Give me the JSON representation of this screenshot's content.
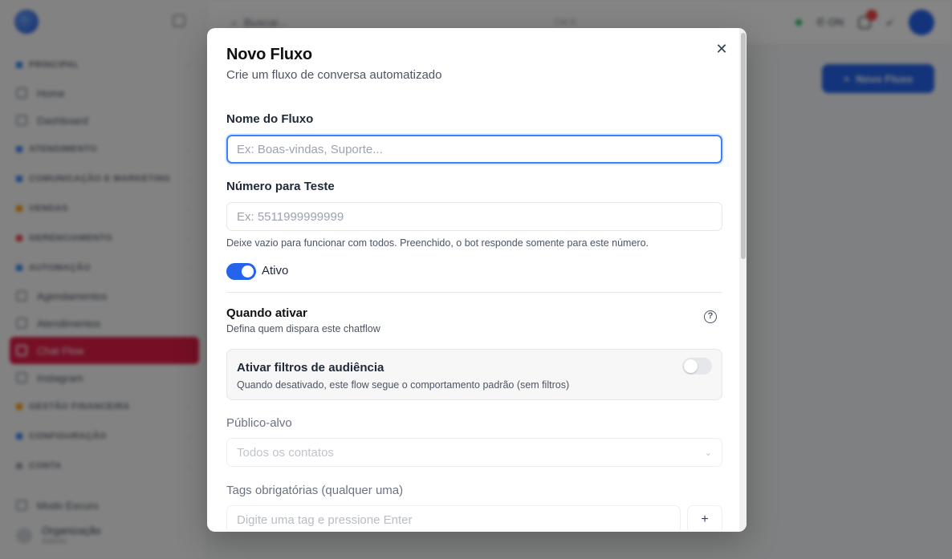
{
  "background": {
    "sidebar": {
      "sections": [
        {
          "label": "PRINCIPAL",
          "color": "#3b82f6"
        },
        {
          "label": "Home",
          "type": "item"
        },
        {
          "label": "Dashboard",
          "type": "item"
        },
        {
          "label": "ATENDIMENTO",
          "color": "#3b82f6"
        },
        {
          "label": "COMUNICAÇÃO E MARKETING",
          "color": "#3b82f6"
        },
        {
          "label": "VENDAS",
          "color": "#f59e0b"
        },
        {
          "label": "GERENCIAMENTO",
          "color": "#ef4444"
        },
        {
          "label": "AUTOMAÇÃO",
          "color": "#3b82f6"
        },
        {
          "label": "Agendamentos",
          "type": "item"
        },
        {
          "label": "Atendimentos",
          "type": "item"
        },
        {
          "label": "Chat Flow",
          "type": "item",
          "active": true
        },
        {
          "label": "Instagram",
          "type": "item"
        },
        {
          "label": "GESTÃO FINANCEIRA",
          "color": "#f59e0b"
        },
        {
          "label": "CONFIGURAÇÃO",
          "color": "#3b82f6"
        },
        {
          "label": "CONTA",
          "color": "#9ca3af"
        }
      ],
      "footer_link": "Modo Escuro",
      "user_name": "Organização",
      "user_role": "Admin"
    },
    "topbar": {
      "search_placeholder": "Buscar...",
      "search_shortcut": "Ctrl K",
      "status": "ON"
    },
    "new_flow_button": "Novo Fluxo"
  },
  "modal": {
    "title": "Novo Fluxo",
    "subtitle": "Crie um fluxo de conversa automatizado",
    "name_label": "Nome do Fluxo",
    "name_placeholder": "Ex: Boas-vindas, Suporte...",
    "name_value": "",
    "test_number_label": "Número para Teste",
    "test_number_placeholder": "Ex: 5511999999999",
    "test_number_value": "",
    "test_number_help": "Deixe vazio para funcionar com todos. Preenchido, o bot responde somente para este número.",
    "active_label": "Ativo",
    "active_on": true,
    "trigger_title": "Quando ativar",
    "trigger_subtitle": "Defina quem dispara este chatflow",
    "audience_filter_title": "Ativar filtros de audiência",
    "audience_filter_subtitle": "Quando desativado, este flow segue o comportamento padrão (sem filtros)",
    "audience_filter_on": false,
    "target_label": "Público-alvo",
    "target_selected": "Todos os contatos",
    "tags_label": "Tags obrigatórias (qualquer uma)",
    "tags_placeholder": "Digite uma tag e pressione Enter",
    "add_tag_label": "+",
    "close_glyph": "✕",
    "help_glyph": "?"
  },
  "colors": {
    "primary": "#2563eb",
    "active_nav": "#e11d48",
    "overlay": "rgba(0,0,0,0.48)"
  }
}
